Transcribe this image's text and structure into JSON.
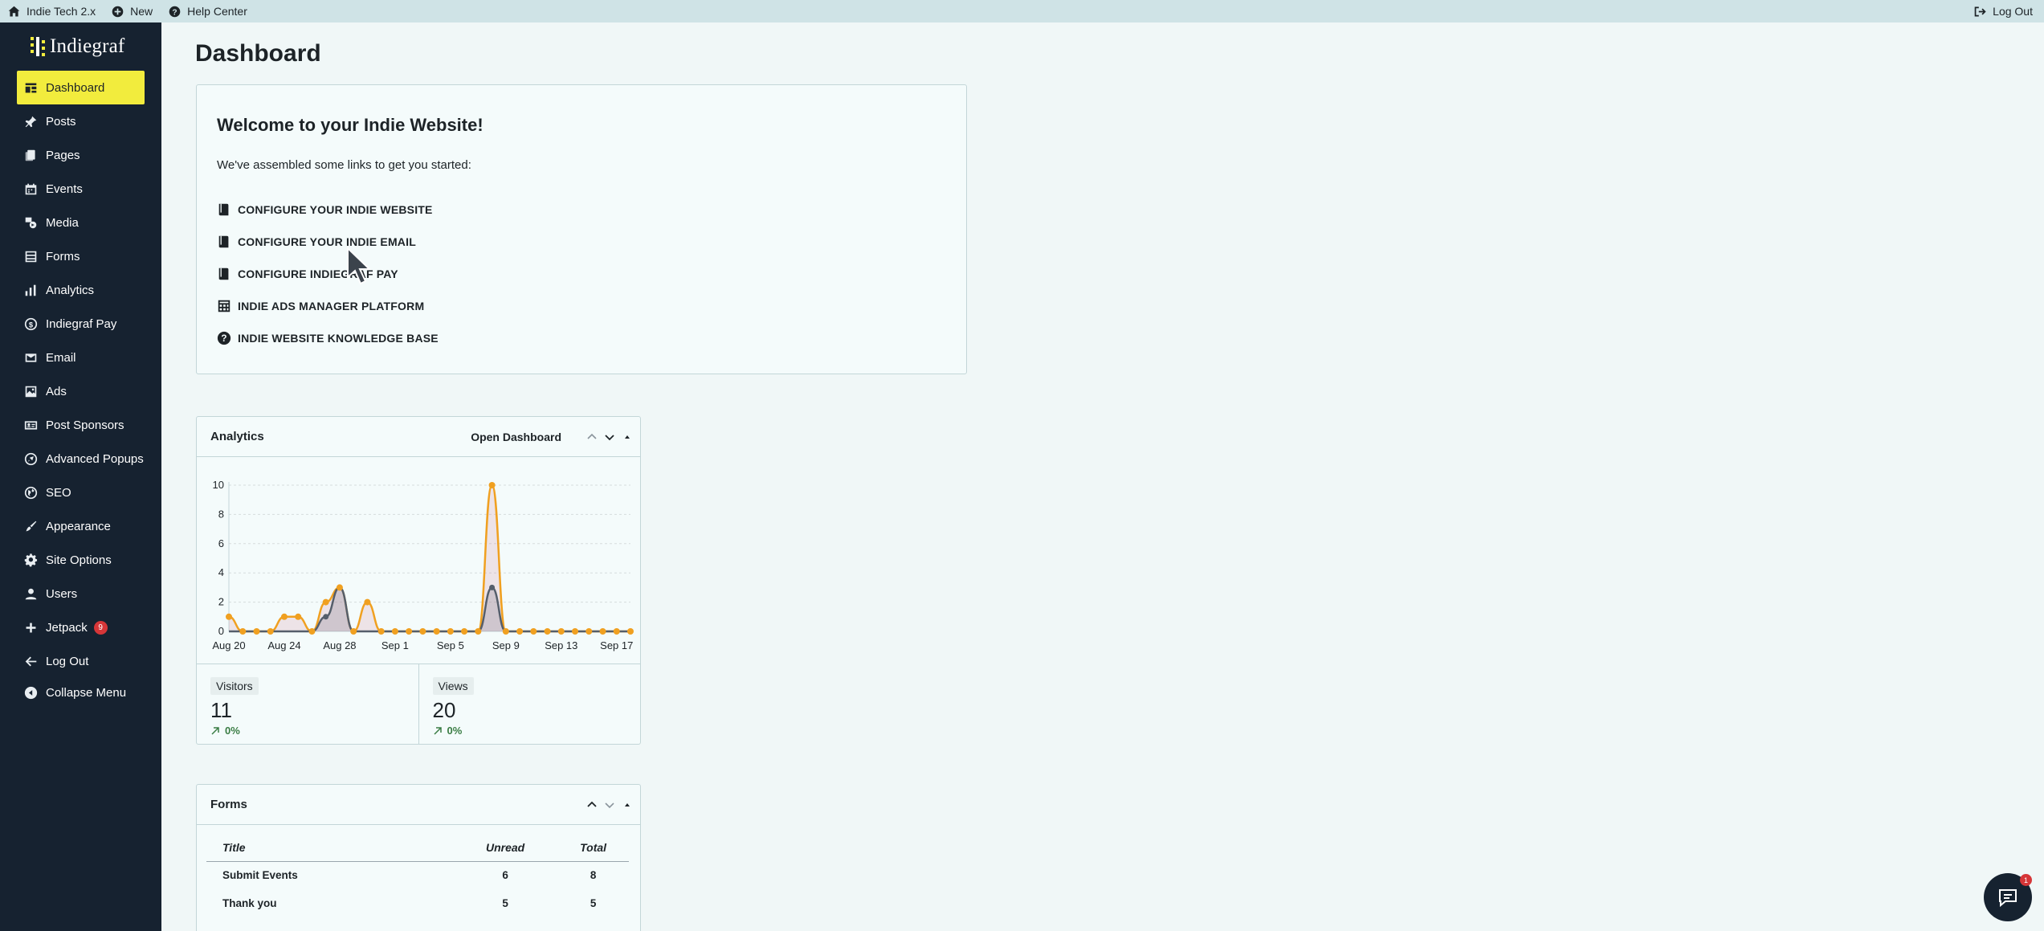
{
  "adminbar": {
    "site_name": "Indie Tech 2.x",
    "new_label": "New",
    "help_label": "Help Center",
    "logout_label": "Log Out"
  },
  "sidebar": {
    "logo_text": "Indiegraf",
    "items": [
      {
        "label": "Dashboard",
        "icon": "dashboard-icon",
        "active": true
      },
      {
        "label": "Posts",
        "icon": "pin-icon"
      },
      {
        "label": "Pages",
        "icon": "pages-icon"
      },
      {
        "label": "Events",
        "icon": "calendar-icon"
      },
      {
        "label": "Media",
        "icon": "media-icon"
      },
      {
        "label": "Forms",
        "icon": "forms-icon"
      },
      {
        "label": "Analytics",
        "icon": "bar-chart-icon"
      },
      {
        "label": "Indiegraf Pay",
        "icon": "dollar-icon"
      },
      {
        "label": "Email",
        "icon": "email-icon"
      },
      {
        "label": "Ads",
        "icon": "image-icon"
      },
      {
        "label": "Post Sponsors",
        "icon": "id-card-icon"
      },
      {
        "label": "Advanced Popups",
        "icon": "rocket-icon"
      },
      {
        "label": "SEO",
        "icon": "globe-icon"
      },
      {
        "label": "Appearance",
        "icon": "brush-icon"
      },
      {
        "label": "Site Options",
        "icon": "gear-icon"
      },
      {
        "label": "Users",
        "icon": "user-icon"
      },
      {
        "label": "Jetpack",
        "icon": "plus-icon",
        "badge": "9"
      },
      {
        "label": "Log Out",
        "icon": "arrow-left-icon"
      },
      {
        "label": "Collapse Menu",
        "icon": "collapse-icon"
      }
    ]
  },
  "main": {
    "title": "Dashboard",
    "welcome": {
      "heading": "Welcome to your Indie Website!",
      "intro": "We've assembled some links to get you started:",
      "links": [
        {
          "label": "CONFIGURE YOUR INDIE WEBSITE",
          "icon": "book-icon"
        },
        {
          "label": "CONFIGURE YOUR INDIE EMAIL",
          "icon": "book-icon"
        },
        {
          "label": "CONFIGURE INDIEGRAF PAY",
          "icon": "book-icon"
        },
        {
          "label": "INDIE ADS MANAGER PLATFORM",
          "icon": "table-icon"
        },
        {
          "label": "INDIE WEBSITE KNOWLEDGE BASE",
          "icon": "help-circle-icon"
        }
      ]
    },
    "analytics_widget": {
      "title": "Analytics",
      "open_dashboard": "Open Dashboard",
      "stats": [
        {
          "label": "Visitors",
          "value": "11",
          "change": "0%"
        },
        {
          "label": "Views",
          "value": "20",
          "change": "0%"
        }
      ]
    },
    "forms_widget": {
      "title": "Forms",
      "columns": [
        "Title",
        "Unread",
        "Total"
      ],
      "rows": [
        [
          "Submit Events",
          "6",
          "8"
        ],
        [
          "Thank you",
          "5",
          "5"
        ]
      ]
    }
  },
  "chat": {
    "badge": "1"
  },
  "colors": {
    "accent": "#f2ec3d",
    "sidebar": "#162230",
    "views_line": "#f0a020",
    "visitors_line": "#555e6b"
  },
  "chart_data": {
    "type": "line",
    "x": [
      "Aug 20",
      "Aug 21",
      "Aug 22",
      "Aug 23",
      "Aug 24",
      "Aug 25",
      "Aug 26",
      "Aug 27",
      "Aug 28",
      "Aug 29",
      "Aug 30",
      "Aug 31",
      "Sep 1",
      "Sep 2",
      "Sep 3",
      "Sep 4",
      "Sep 5",
      "Sep 6",
      "Sep 7",
      "Sep 8",
      "Sep 9",
      "Sep 10",
      "Sep 11",
      "Sep 12",
      "Sep 13",
      "Sep 14",
      "Sep 15",
      "Sep 16",
      "Sep 17",
      "Sep 18"
    ],
    "tick_labels": [
      "Aug 20",
      "Aug 24",
      "Aug 28",
      "Sep 1",
      "Sep 5",
      "Sep 9",
      "Sep 13",
      "Sep 17"
    ],
    "series": [
      {
        "values": [
          1,
          0,
          0,
          0,
          1,
          1,
          0,
          2,
          3,
          0,
          2,
          0,
          0,
          0,
          0,
          0,
          0,
          0,
          0,
          10,
          0,
          0,
          0,
          0,
          0,
          0,
          0,
          0,
          0,
          0
        ]
      },
      {
        "values": [
          0,
          0,
          0,
          0,
          0,
          0,
          0,
          1,
          3,
          0,
          0,
          0,
          0,
          0,
          0,
          0,
          0,
          0,
          0,
          3,
          0,
          0,
          0,
          0,
          0,
          0,
          0,
          0,
          0,
          0
        ]
      }
    ],
    "ylim": [
      0,
      10
    ],
    "yticks": [
      0,
      2,
      4,
      6,
      8,
      10
    ],
    "grid": true
  }
}
